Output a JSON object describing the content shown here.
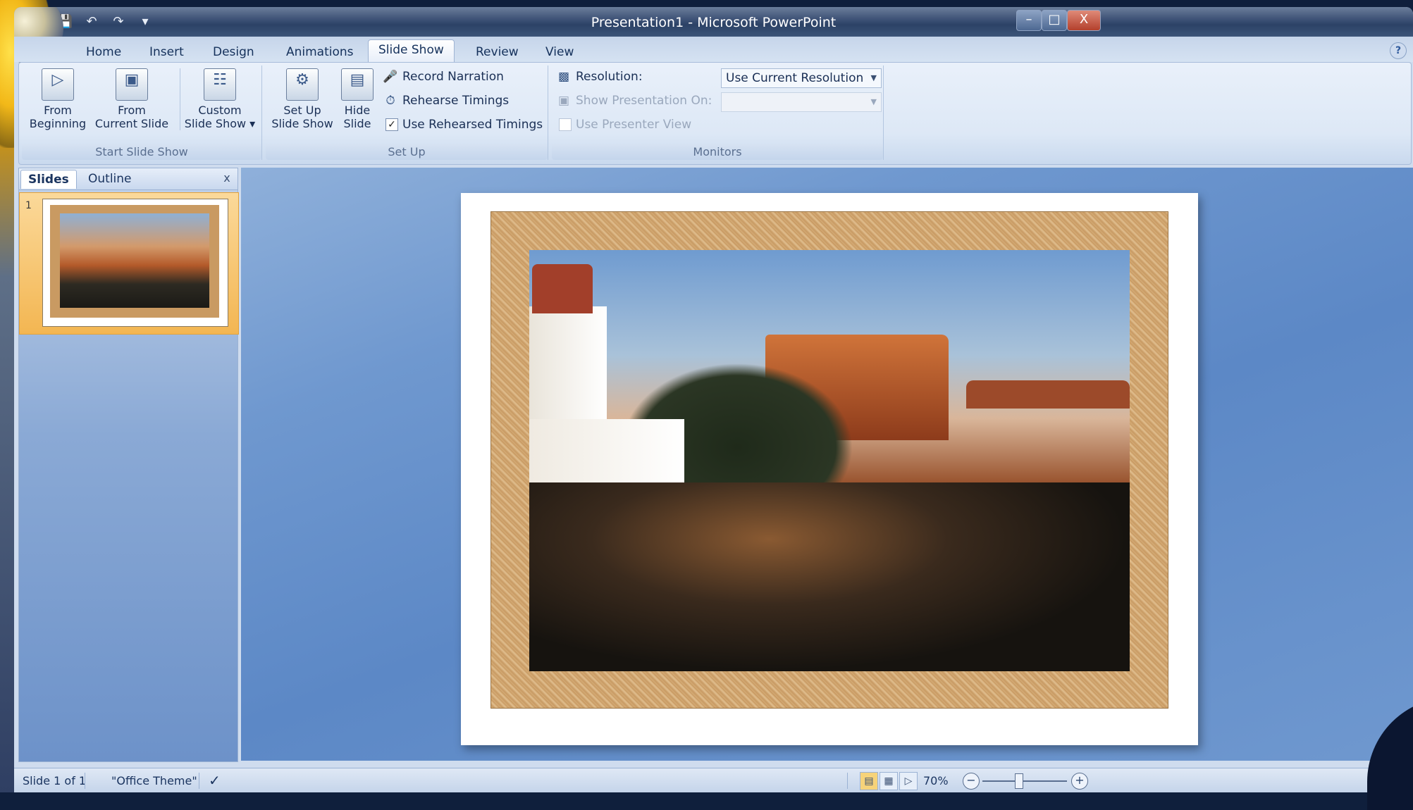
{
  "window": {
    "title": "Presentation1 - Microsoft PowerPoint",
    "controls": {
      "minimize": "–",
      "maximize": "□",
      "close": "X"
    }
  },
  "qat": {
    "save": "💾",
    "undo": "↶",
    "redo": "↷",
    "customize": "▾"
  },
  "ribbon": {
    "tabs": [
      "Home",
      "Insert",
      "Design",
      "Animations",
      "Slide Show",
      "Review",
      "View"
    ],
    "active_tab": "Slide Show",
    "help": "?",
    "groups": {
      "start": {
        "label": "Start Slide Show",
        "from_beginning": {
          "line1": "From",
          "line2": "Beginning"
        },
        "from_current": {
          "line1": "From",
          "line2": "Current Slide"
        },
        "custom": {
          "line1": "Custom",
          "line2": "Slide Show ▾"
        }
      },
      "setup": {
        "label": "Set Up",
        "set_up": {
          "line1": "Set Up",
          "line2": "Slide Show"
        },
        "hide": {
          "line1": "Hide",
          "line2": "Slide"
        },
        "record_narration": "Record Narration",
        "rehearse_timings": "Rehearse Timings",
        "use_rehearsed": "Use Rehearsed Timings",
        "use_rehearsed_checked": true
      },
      "monitors": {
        "label": "Monitors",
        "resolution_label": "Resolution:",
        "resolution_value": "Use Current Resolution",
        "show_on_label": "Show Presentation On:",
        "presenter_view": "Use Presenter View"
      }
    }
  },
  "left_pane": {
    "tabs": [
      "Slides",
      "Outline"
    ],
    "active_tab": "Slides",
    "close": "x",
    "slides": [
      {
        "number": "1"
      }
    ]
  },
  "status_bar": {
    "slide_info": "Slide 1 of 1",
    "theme": "\"Office Theme\"",
    "spell_icon": "✓",
    "zoom": "70%",
    "zoom_out": "−",
    "zoom_in": "+"
  },
  "colors": {
    "titlebar": "#2c4266",
    "ribbon_bg": "#dde8f6",
    "thumb_selected": "#f3b652",
    "workspace": "#5c88c6"
  }
}
